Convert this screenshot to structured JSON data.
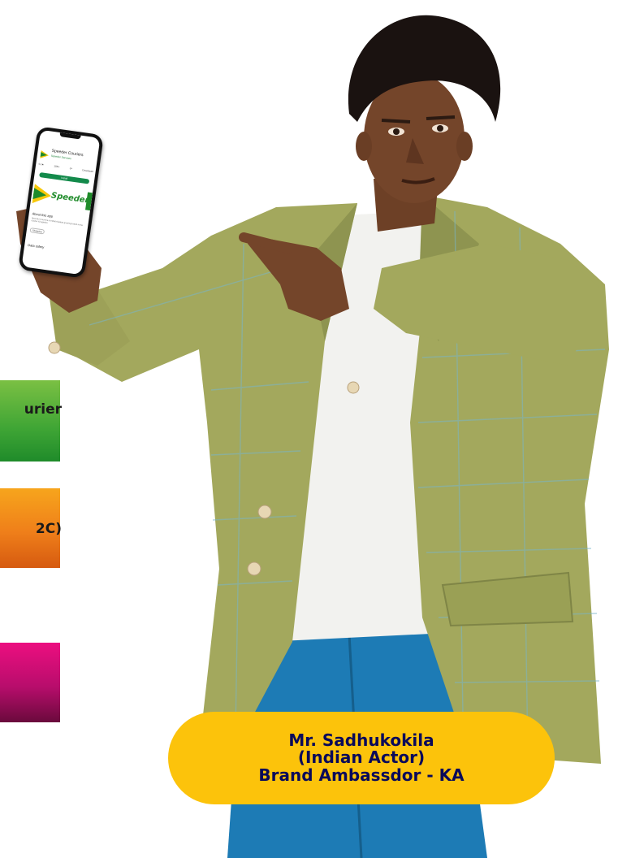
{
  "tiles": [
    {
      "id": "green",
      "label_fragment": "urier"
    },
    {
      "id": "orange",
      "label_fragment": "2C)"
    },
    {
      "id": "pink",
      "label_fragment": ""
    }
  ],
  "phone": {
    "app_name": "Speeder Couriers",
    "developer": "Speeder Services",
    "stats": [
      "4.1★",
      "10K+",
      "3+",
      "Download"
    ],
    "install_label": "Install",
    "banner_text": "Speeder",
    "about_title": "About this app",
    "about_body": "Speeder Couriers is India's fastest growing brand in the courier & logistics",
    "chip": "Shopping",
    "data_safety": "Data safety"
  },
  "caption": {
    "line1": "Mr. Sadhukokila",
    "line2": "(Indian Actor)",
    "line3": "Brand Ambassdor - KA"
  },
  "colors": {
    "caption_bg": "#fcc30b",
    "caption_text": "#0a0a5a",
    "green_tile": "#3fa535",
    "orange_tile": "#ef7f1a",
    "pink_tile": "#b80d6c",
    "jacket": "#a3a85d",
    "trousers": "#1d7bb5"
  }
}
